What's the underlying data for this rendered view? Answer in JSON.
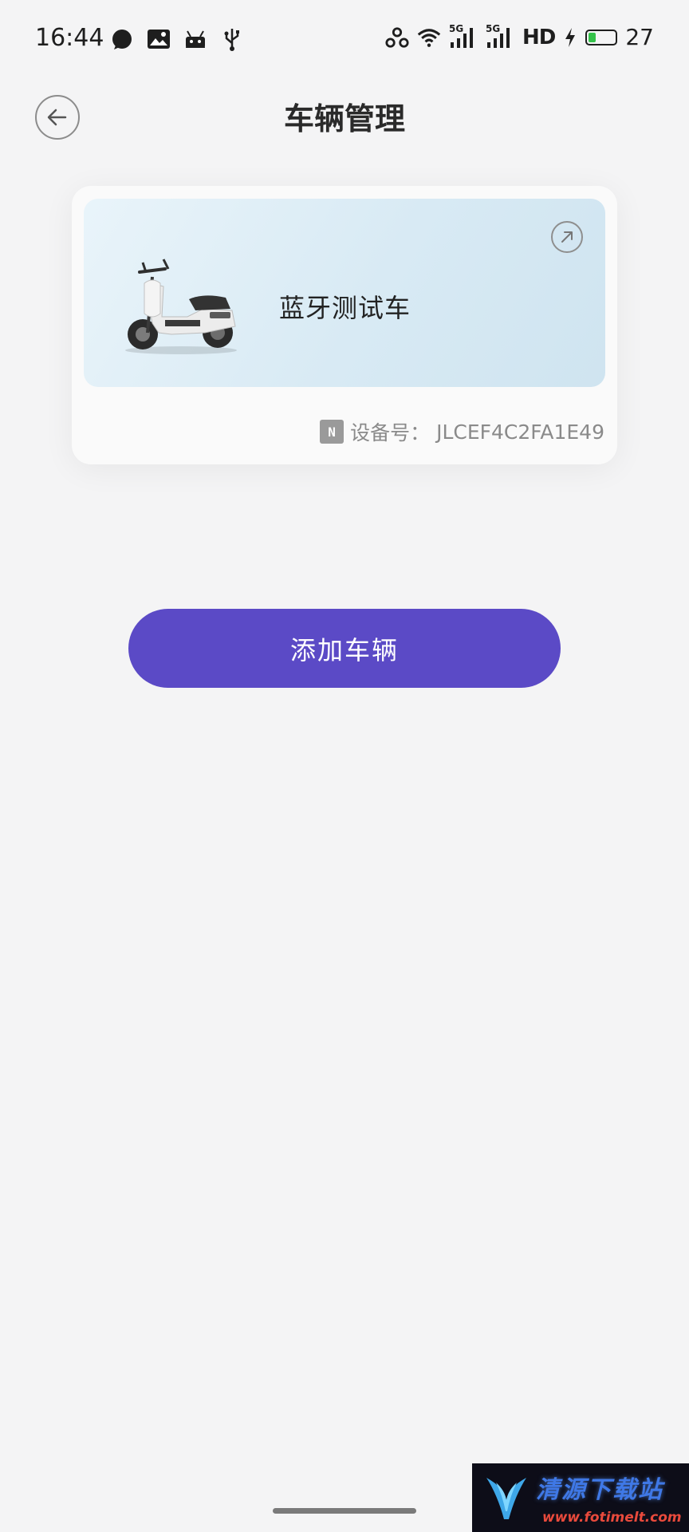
{
  "status_bar": {
    "time": "16:44",
    "left_icons": [
      "chat-bubble-icon",
      "gallery-icon",
      "android-icon",
      "usb-icon"
    ],
    "right_icons": [
      "hotspot-icon",
      "wifi-icon",
      "signal-5g-icon",
      "signal-5g-icon",
      "charging-icon",
      "battery-icon"
    ],
    "signal1_label": "5G",
    "signal2_label": "5G",
    "hd_label": "HD",
    "battery_level": 0.27,
    "battery_text": "27",
    "battery_color": "#34c24a"
  },
  "header": {
    "title": "车辆管理",
    "back_icon": "arrow-left-icon"
  },
  "vehicle_card": {
    "name": "蓝牙测试车",
    "device_label": "设备号：",
    "device_id": "JLCEF4C2FA1E49",
    "nfc_icon_text": "N",
    "open_icon": "arrow-up-right-icon"
  },
  "actions": {
    "add_vehicle_label": "添加车辆",
    "accent_color": "#5b4ac6"
  },
  "watermark": {
    "title": "清源下载站",
    "url": "www.fotimelt.com"
  }
}
